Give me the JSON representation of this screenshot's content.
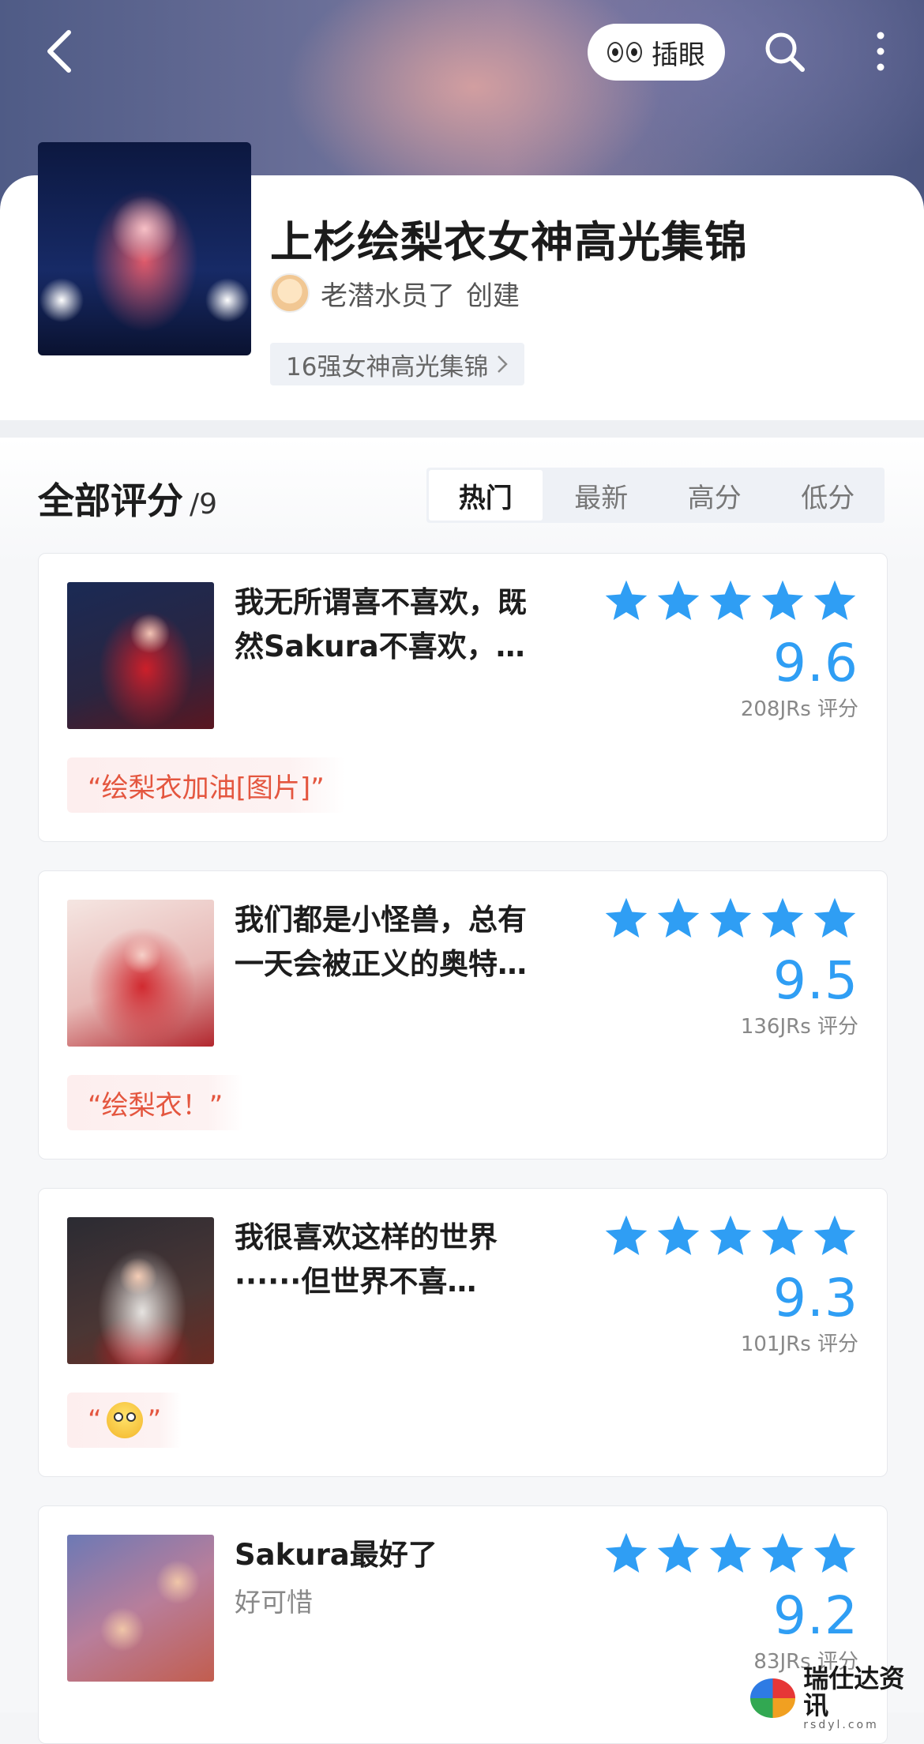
{
  "topbar": {
    "peek_label": "插眼"
  },
  "header": {
    "title": "上杉绘梨衣女神高光集锦",
    "creator_name": "老潜水员了",
    "creator_action": "创建",
    "collection_tag": "16强女神高光集锦"
  },
  "section": {
    "title": "全部评分",
    "count": "/9"
  },
  "tabs": [
    {
      "label": "热门",
      "active": true
    },
    {
      "label": "最新",
      "active": false
    },
    {
      "label": "高分",
      "active": false
    },
    {
      "label": "低分",
      "active": false
    }
  ],
  "ratings": [
    {
      "title_line1": "我无所谓喜不喜欢，既",
      "title_line2": "然Sakura不喜欢，…",
      "score": "9.6",
      "raters": "208JRs 评分",
      "quote": "“绘梨衣加油[图片]”",
      "stars": 5
    },
    {
      "title_line1": "我们都是小怪兽，总有",
      "title_line2": "一天会被正义的奥特…",
      "score": "9.5",
      "raters": "136JRs 评分",
      "quote": "“绘梨衣！”",
      "stars": 5
    },
    {
      "title_line1": "我很喜欢这样的世界",
      "title_line2": "······但世界不喜…",
      "score": "9.3",
      "raters": "101JRs 评分",
      "quote_open": "“",
      "quote_close": "”",
      "stars": 5
    },
    {
      "title_line1": "Sakura最好了",
      "subtitle": "好可惜",
      "score": "9.2",
      "raters": "83JRs 评分",
      "stars": 5
    }
  ],
  "watermark": {
    "name": "瑞仕达资讯",
    "site": "rsdyl.com"
  }
}
